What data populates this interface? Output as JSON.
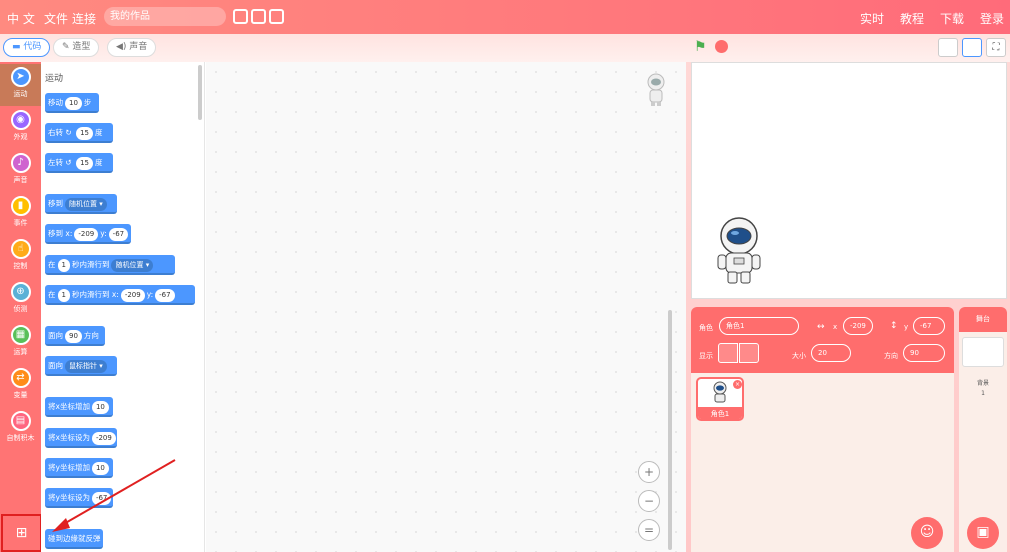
{
  "topbar": {
    "lang": "中 文",
    "file": "文件",
    "connect": "连接",
    "project_name": "我的作品",
    "right_items": [
      "实时",
      "教程",
      "下载",
      "登录"
    ]
  },
  "tabs": {
    "code": "代码",
    "costume": "造型",
    "sound": "声音"
  },
  "categories": [
    {
      "label": "运动",
      "icon": "motion-icon",
      "color": "#4c97ff"
    },
    {
      "label": "外观",
      "icon": "looks-icon",
      "color": "#9966ff"
    },
    {
      "label": "声音",
      "icon": "sound-icon",
      "color": "#cf63cf"
    },
    {
      "label": "事件",
      "icon": "events-icon",
      "color": "#ffbf00"
    },
    {
      "label": "控制",
      "icon": "control-icon",
      "color": "#ffab19"
    },
    {
      "label": "侦测",
      "icon": "sensing-icon",
      "color": "#5cb1d6"
    },
    {
      "label": "运算",
      "icon": "operators-icon",
      "color": "#59c059"
    },
    {
      "label": "变量",
      "icon": "variables-icon",
      "color": "#ff8c1a"
    },
    {
      "label": "自制积木",
      "icon": "myblocks-icon",
      "color": "#ff6680"
    }
  ],
  "palette": {
    "section_title": "运动",
    "blocks": {
      "move": {
        "pre": "移动",
        "val": "10",
        "post": "步"
      },
      "turn_right": {
        "pre": "右转",
        "val": "15",
        "post": "度"
      },
      "turn_left": {
        "pre": "左转",
        "val": "15",
        "post": "度"
      },
      "goto": {
        "pre": "移到",
        "dd": "随机位置"
      },
      "goto_xy": {
        "pre": "移到 x:",
        "x": "-209",
        "mid": "y:",
        "y": "-67"
      },
      "glide": {
        "pre": "在",
        "val": "1",
        "mid": "秒内滑行到",
        "dd": "随机位置"
      },
      "glide_xy": {
        "pre": "在",
        "val": "1",
        "mid": "秒内滑行到 x:",
        "x": "-209",
        "mid2": "y:",
        "y": "-67"
      },
      "point_dir": {
        "pre": "面向",
        "val": "90",
        "post": "方向"
      },
      "point_towards": {
        "pre": "面向",
        "dd": "鼠标指针"
      },
      "change_x": {
        "pre": "将x坐标增加",
        "val": "10"
      },
      "set_x": {
        "pre": "将x坐标设为",
        "val": "-209"
      },
      "change_y": {
        "pre": "将y坐标增加",
        "val": "10"
      },
      "set_y": {
        "pre": "将y坐标设为",
        "val": "-67"
      },
      "bounce": {
        "pre": "碰到边缘就反弹"
      }
    }
  },
  "sprite_info": {
    "sprite_label": "角色",
    "sprite_name": "角色1",
    "x_label": "x",
    "x": "-209",
    "y_label": "y",
    "y": "-67",
    "show_label": "显示",
    "size_label": "大小",
    "size": "20",
    "direction_label": "方向",
    "direction": "90"
  },
  "sprite_list": [
    {
      "name": "角色1",
      "selected": true
    }
  ],
  "stage_panel": {
    "title": "舞台",
    "backdrop_label": "背景",
    "backdrop_count": "1"
  },
  "colors": {
    "accent": "#ff6d6d",
    "motion": "#4c97ff"
  }
}
